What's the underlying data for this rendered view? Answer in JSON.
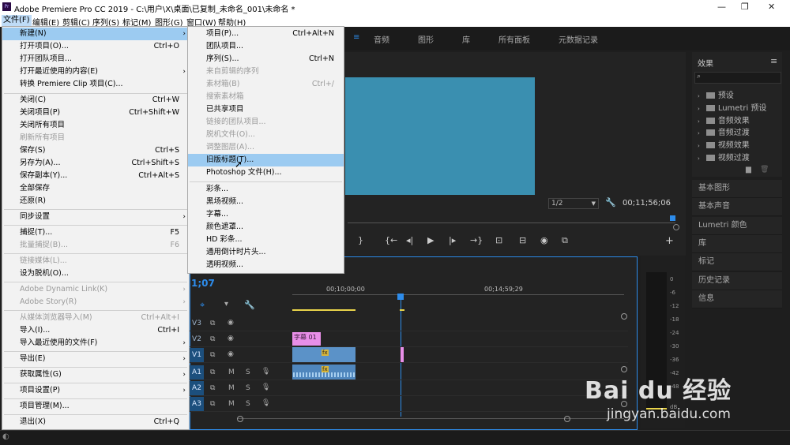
{
  "window": {
    "title": "Adobe Premiere Pro CC 2019 - C:\\用户\\X\\桌面\\已复制_未命名_001\\未命名 *",
    "logo": "Pr",
    "controls": [
      "minimize-icon",
      "restore-icon",
      "close-icon"
    ]
  },
  "menubar": [
    "文件(F)",
    "编辑(E)",
    "剪辑(C)",
    "序列(S)",
    "标记(M)",
    "图形(G)",
    "窗口(W)",
    "帮助(H)"
  ],
  "workspace_tabs": [
    "音频",
    "图形",
    "库",
    "所有面板",
    "元数据记录"
  ],
  "file_menu": [
    {
      "label": "新建(N)",
      "shortcut": "",
      "arrow": true,
      "state": "highlight"
    },
    {
      "label": "打开项目(O)...",
      "shortcut": "Ctrl+O"
    },
    {
      "label": "打开团队项目...",
      "shortcut": ""
    },
    {
      "label": "打开最近使用的内容(E)",
      "shortcut": "",
      "arrow": true
    },
    {
      "label": "转换 Premiere Clip 项目(C)...",
      "shortcut": ""
    },
    {
      "label": "关闭(C)",
      "shortcut": "Ctrl+W"
    },
    {
      "label": "关闭项目(P)",
      "shortcut": "Ctrl+Shift+W"
    },
    {
      "label": "关闭所有项目",
      "shortcut": ""
    },
    {
      "label": "刷新所有项目",
      "shortcut": "",
      "state": "disabled"
    },
    {
      "label": "保存(S)",
      "shortcut": "Ctrl+S"
    },
    {
      "label": "另存为(A)...",
      "shortcut": "Ctrl+Shift+S"
    },
    {
      "label": "保存副本(Y)...",
      "shortcut": "Ctrl+Alt+S"
    },
    {
      "label": "全部保存",
      "shortcut": ""
    },
    {
      "label": "还原(R)",
      "shortcut": ""
    },
    {
      "label": "同步设置",
      "shortcut": "",
      "arrow": true
    },
    {
      "label": "捕捉(T)...",
      "shortcut": "F5"
    },
    {
      "label": "批量捕捉(B)...",
      "shortcut": "F6",
      "state": "disabled"
    },
    {
      "label": "链接媒体(L)...",
      "shortcut": "",
      "state": "disabled"
    },
    {
      "label": "设为脱机(O)...",
      "shortcut": ""
    },
    {
      "label": "Adobe Dynamic Link(K)",
      "shortcut": "",
      "arrow": true,
      "state": "disabled"
    },
    {
      "label": "Adobe Story(R)",
      "shortcut": "",
      "arrow": true,
      "state": "disabled"
    },
    {
      "label": "从媒体浏览器导入(M)",
      "shortcut": "Ctrl+Alt+I",
      "state": "disabled"
    },
    {
      "label": "导入(I)...",
      "shortcut": "Ctrl+I"
    },
    {
      "label": "导入最近使用的文件(F)",
      "shortcut": "",
      "arrow": true
    },
    {
      "label": "导出(E)",
      "shortcut": "",
      "arrow": true
    },
    {
      "label": "获取属性(G)",
      "shortcut": "",
      "arrow": true
    },
    {
      "label": "项目设置(P)",
      "shortcut": "",
      "arrow": true
    },
    {
      "label": "项目管理(M)...",
      "shortcut": ""
    },
    {
      "label": "退出(X)",
      "shortcut": "Ctrl+Q"
    }
  ],
  "new_submenu": [
    {
      "label": "项目(P)...",
      "shortcut": "Ctrl+Alt+N"
    },
    {
      "label": "团队项目...",
      "shortcut": ""
    },
    {
      "label": "序列(S)...",
      "shortcut": "Ctrl+N"
    },
    {
      "label": "来自剪辑的序列",
      "shortcut": "",
      "state": "disabled"
    },
    {
      "label": "素材箱(B)",
      "shortcut": "Ctrl+/",
      "state": "disabled"
    },
    {
      "label": "搜索素材箱",
      "shortcut": "",
      "state": "disabled"
    },
    {
      "label": "已共享项目",
      "shortcut": ""
    },
    {
      "label": "链接的团队项目...",
      "shortcut": "",
      "state": "disabled"
    },
    {
      "label": "脱机文件(O)...",
      "shortcut": "",
      "state": "disabled"
    },
    {
      "label": "调整图层(A)...",
      "shortcut": "",
      "state": "disabled"
    },
    {
      "label": "旧版标题(T)...",
      "shortcut": "",
      "state": "highlight"
    },
    {
      "label": "Photoshop 文件(H)...",
      "shortcut": ""
    },
    {
      "label": "彩条...",
      "shortcut": ""
    },
    {
      "label": "黑场视频...",
      "shortcut": ""
    },
    {
      "label": "字幕...",
      "shortcut": ""
    },
    {
      "label": "颜色遮罩...",
      "shortcut": ""
    },
    {
      "label": "HD 彩条...",
      "shortcut": ""
    },
    {
      "label": "通用倒计时片头...",
      "shortcut": ""
    },
    {
      "label": "透明视频...",
      "shortcut": ""
    }
  ],
  "program_monitor": {
    "resolution": "1/2",
    "timecode": "00;11;56;06",
    "frame_color": "#3a8fb0"
  },
  "timeline": {
    "current_time": "1;07",
    "ruler": [
      "00;10;00;00",
      "00;14;59;29"
    ],
    "video_tracks": [
      "V3",
      "V2",
      "V1"
    ],
    "audio_tracks": [
      "A1",
      "A2",
      "A3"
    ],
    "track_m": "M",
    "track_s": "S",
    "caption_clip": "字幕 01",
    "fx_badge": "fx"
  },
  "effects_panel": {
    "title": "效果",
    "items": [
      "预设",
      "Lumetri 预设",
      "音频效果",
      "音频过渡",
      "视频效果",
      "视频过渡"
    ]
  },
  "side_panels": [
    "基本图形",
    "基本声音",
    "Lumetri 颜色",
    "库",
    "标记",
    "历史记录",
    "信息"
  ],
  "audio_meter": {
    "labels": [
      "0",
      "-6",
      "-12",
      "-18",
      "-24",
      "-30",
      "-36",
      "-42",
      "-48",
      "dB"
    ]
  },
  "watermark": {
    "brand": "Bai du 经验",
    "url": "jingyan.baidu.com"
  },
  "colors": {
    "menu_highlight": "#9ccbf1",
    "accent_blue": "#2d8ceb",
    "caption_clip": "#e98fe8"
  }
}
